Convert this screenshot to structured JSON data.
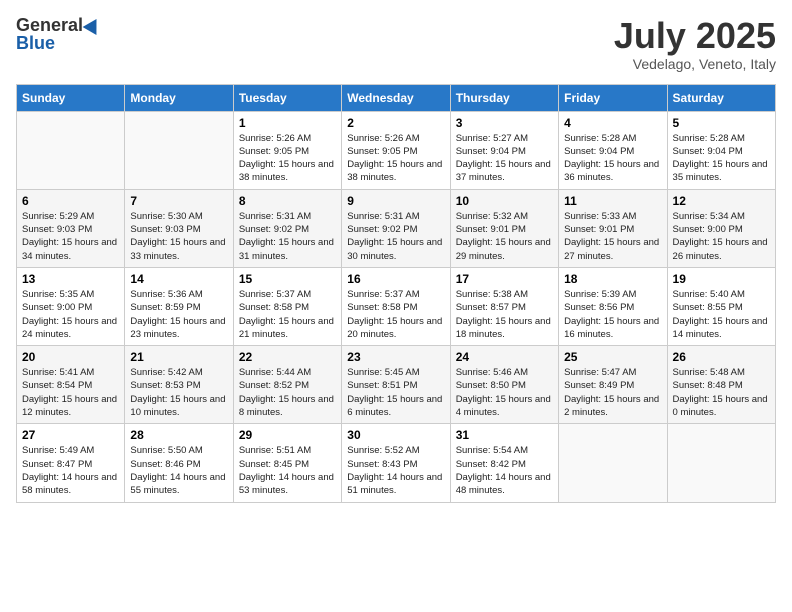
{
  "header": {
    "logo_general": "General",
    "logo_blue": "Blue",
    "month": "July 2025",
    "location": "Vedelago, Veneto, Italy"
  },
  "days_of_week": [
    "Sunday",
    "Monday",
    "Tuesday",
    "Wednesday",
    "Thursday",
    "Friday",
    "Saturday"
  ],
  "weeks": [
    [
      {
        "day": null
      },
      {
        "day": null
      },
      {
        "day": "1",
        "sunrise": "Sunrise: 5:26 AM",
        "sunset": "Sunset: 9:05 PM",
        "daylight": "Daylight: 15 hours and 38 minutes."
      },
      {
        "day": "2",
        "sunrise": "Sunrise: 5:26 AM",
        "sunset": "Sunset: 9:05 PM",
        "daylight": "Daylight: 15 hours and 38 minutes."
      },
      {
        "day": "3",
        "sunrise": "Sunrise: 5:27 AM",
        "sunset": "Sunset: 9:04 PM",
        "daylight": "Daylight: 15 hours and 37 minutes."
      },
      {
        "day": "4",
        "sunrise": "Sunrise: 5:28 AM",
        "sunset": "Sunset: 9:04 PM",
        "daylight": "Daylight: 15 hours and 36 minutes."
      },
      {
        "day": "5",
        "sunrise": "Sunrise: 5:28 AM",
        "sunset": "Sunset: 9:04 PM",
        "daylight": "Daylight: 15 hours and 35 minutes."
      }
    ],
    [
      {
        "day": "6",
        "sunrise": "Sunrise: 5:29 AM",
        "sunset": "Sunset: 9:03 PM",
        "daylight": "Daylight: 15 hours and 34 minutes."
      },
      {
        "day": "7",
        "sunrise": "Sunrise: 5:30 AM",
        "sunset": "Sunset: 9:03 PM",
        "daylight": "Daylight: 15 hours and 33 minutes."
      },
      {
        "day": "8",
        "sunrise": "Sunrise: 5:31 AM",
        "sunset": "Sunset: 9:02 PM",
        "daylight": "Daylight: 15 hours and 31 minutes."
      },
      {
        "day": "9",
        "sunrise": "Sunrise: 5:31 AM",
        "sunset": "Sunset: 9:02 PM",
        "daylight": "Daylight: 15 hours and 30 minutes."
      },
      {
        "day": "10",
        "sunrise": "Sunrise: 5:32 AM",
        "sunset": "Sunset: 9:01 PM",
        "daylight": "Daylight: 15 hours and 29 minutes."
      },
      {
        "day": "11",
        "sunrise": "Sunrise: 5:33 AM",
        "sunset": "Sunset: 9:01 PM",
        "daylight": "Daylight: 15 hours and 27 minutes."
      },
      {
        "day": "12",
        "sunrise": "Sunrise: 5:34 AM",
        "sunset": "Sunset: 9:00 PM",
        "daylight": "Daylight: 15 hours and 26 minutes."
      }
    ],
    [
      {
        "day": "13",
        "sunrise": "Sunrise: 5:35 AM",
        "sunset": "Sunset: 9:00 PM",
        "daylight": "Daylight: 15 hours and 24 minutes."
      },
      {
        "day": "14",
        "sunrise": "Sunrise: 5:36 AM",
        "sunset": "Sunset: 8:59 PM",
        "daylight": "Daylight: 15 hours and 23 minutes."
      },
      {
        "day": "15",
        "sunrise": "Sunrise: 5:37 AM",
        "sunset": "Sunset: 8:58 PM",
        "daylight": "Daylight: 15 hours and 21 minutes."
      },
      {
        "day": "16",
        "sunrise": "Sunrise: 5:37 AM",
        "sunset": "Sunset: 8:58 PM",
        "daylight": "Daylight: 15 hours and 20 minutes."
      },
      {
        "day": "17",
        "sunrise": "Sunrise: 5:38 AM",
        "sunset": "Sunset: 8:57 PM",
        "daylight": "Daylight: 15 hours and 18 minutes."
      },
      {
        "day": "18",
        "sunrise": "Sunrise: 5:39 AM",
        "sunset": "Sunset: 8:56 PM",
        "daylight": "Daylight: 15 hours and 16 minutes."
      },
      {
        "day": "19",
        "sunrise": "Sunrise: 5:40 AM",
        "sunset": "Sunset: 8:55 PM",
        "daylight": "Daylight: 15 hours and 14 minutes."
      }
    ],
    [
      {
        "day": "20",
        "sunrise": "Sunrise: 5:41 AM",
        "sunset": "Sunset: 8:54 PM",
        "daylight": "Daylight: 15 hours and 12 minutes."
      },
      {
        "day": "21",
        "sunrise": "Sunrise: 5:42 AM",
        "sunset": "Sunset: 8:53 PM",
        "daylight": "Daylight: 15 hours and 10 minutes."
      },
      {
        "day": "22",
        "sunrise": "Sunrise: 5:44 AM",
        "sunset": "Sunset: 8:52 PM",
        "daylight": "Daylight: 15 hours and 8 minutes."
      },
      {
        "day": "23",
        "sunrise": "Sunrise: 5:45 AM",
        "sunset": "Sunset: 8:51 PM",
        "daylight": "Daylight: 15 hours and 6 minutes."
      },
      {
        "day": "24",
        "sunrise": "Sunrise: 5:46 AM",
        "sunset": "Sunset: 8:50 PM",
        "daylight": "Daylight: 15 hours and 4 minutes."
      },
      {
        "day": "25",
        "sunrise": "Sunrise: 5:47 AM",
        "sunset": "Sunset: 8:49 PM",
        "daylight": "Daylight: 15 hours and 2 minutes."
      },
      {
        "day": "26",
        "sunrise": "Sunrise: 5:48 AM",
        "sunset": "Sunset: 8:48 PM",
        "daylight": "Daylight: 15 hours and 0 minutes."
      }
    ],
    [
      {
        "day": "27",
        "sunrise": "Sunrise: 5:49 AM",
        "sunset": "Sunset: 8:47 PM",
        "daylight": "Daylight: 14 hours and 58 minutes."
      },
      {
        "day": "28",
        "sunrise": "Sunrise: 5:50 AM",
        "sunset": "Sunset: 8:46 PM",
        "daylight": "Daylight: 14 hours and 55 minutes."
      },
      {
        "day": "29",
        "sunrise": "Sunrise: 5:51 AM",
        "sunset": "Sunset: 8:45 PM",
        "daylight": "Daylight: 14 hours and 53 minutes."
      },
      {
        "day": "30",
        "sunrise": "Sunrise: 5:52 AM",
        "sunset": "Sunset: 8:43 PM",
        "daylight": "Daylight: 14 hours and 51 minutes."
      },
      {
        "day": "31",
        "sunrise": "Sunrise: 5:54 AM",
        "sunset": "Sunset: 8:42 PM",
        "daylight": "Daylight: 14 hours and 48 minutes."
      },
      {
        "day": null
      },
      {
        "day": null
      }
    ]
  ]
}
